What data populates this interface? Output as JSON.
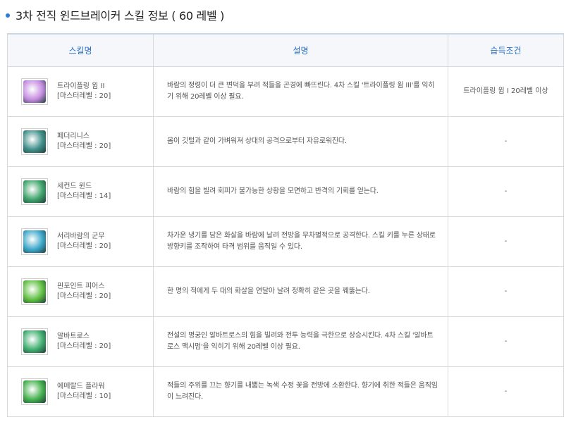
{
  "page": {
    "title": "3차 전직 윈드브레이커 스킬 정보 ( 60 레벨 )"
  },
  "table": {
    "headers": [
      "스킬명",
      "설명",
      "습득조건"
    ],
    "rows": [
      {
        "name": "트라이플링 윔 II",
        "master": "[마스터레벨 : 20]",
        "desc": "바람의 정령이 더 큰 변덕을 부려 적들을 곤경에 빠뜨린다. 4차 스킬 '트라이플링 윔 III'를 익히기 위해 20레벨 이상 필요.",
        "cond": "트라이플링 윔 I 20레벨 이상",
        "icon": "trifling-whim-icon",
        "color": "#c58be0"
      },
      {
        "name": "페더리니스",
        "master": "[마스터레벨 : 20]",
        "desc": "몸이 깃털과 같이 가벼워져 상대의 공격으로부터 자유로워진다.",
        "cond": "-",
        "icon": "featherness-icon",
        "color": "#3f8f8a"
      },
      {
        "name": "세컨드 윈드",
        "master": "[마스터레벨 : 14]",
        "desc": "바람의 힘을 빌려 회피가 불가능한 상황을 모면하고 반격의 기회를 얻는다.",
        "cond": "-",
        "icon": "second-wind-icon",
        "color": "#3ea36a"
      },
      {
        "name": "서리바람의 군무",
        "master": "[마스터레벨 : 20]",
        "desc": "차가운 냉기를 담은 화살을 바람에 날려 전방을 무차별적으로 공격한다. 스킬 키를 누른 상태로 방향키를 조작하여 타격 범위를 움직일 수 있다.",
        "cond": "-",
        "icon": "frost-wind-dance-icon",
        "color": "#3aa6c9"
      },
      {
        "name": "핀포인트 피어스",
        "master": "[마스터레벨 : 20]",
        "desc": "한 명의 적에게 두 대의 화살을 연달아 날려 정확히 같은 곳을 꿰뚫는다.",
        "cond": "-",
        "icon": "pinpoint-pierce-icon",
        "color": "#5fbf3f"
      },
      {
        "name": "알바트로스",
        "master": "[마스터레벨 : 20]",
        "desc": "전설의 명궁인 알바트로스의 힘을 빌려와 전투 능력을 극한으로 상승시킨다. 4차 스킬 '알바트로스 맥시멈'을 익히기 위해 20레벨 이상 필요.",
        "cond": "-",
        "icon": "albatross-icon",
        "color": "#3fae6e"
      },
      {
        "name": "에메랄드 플라워",
        "master": "[마스터레벨 : 10]",
        "desc": "적들의 주위를 끄는 향기를 내뿜는 녹색 수정 꽃을 전방에 소환한다. 향기에 취한 적들은 움직임이 느려진다.",
        "cond": "-",
        "icon": "emerald-flower-icon",
        "color": "#44b04c"
      }
    ]
  }
}
